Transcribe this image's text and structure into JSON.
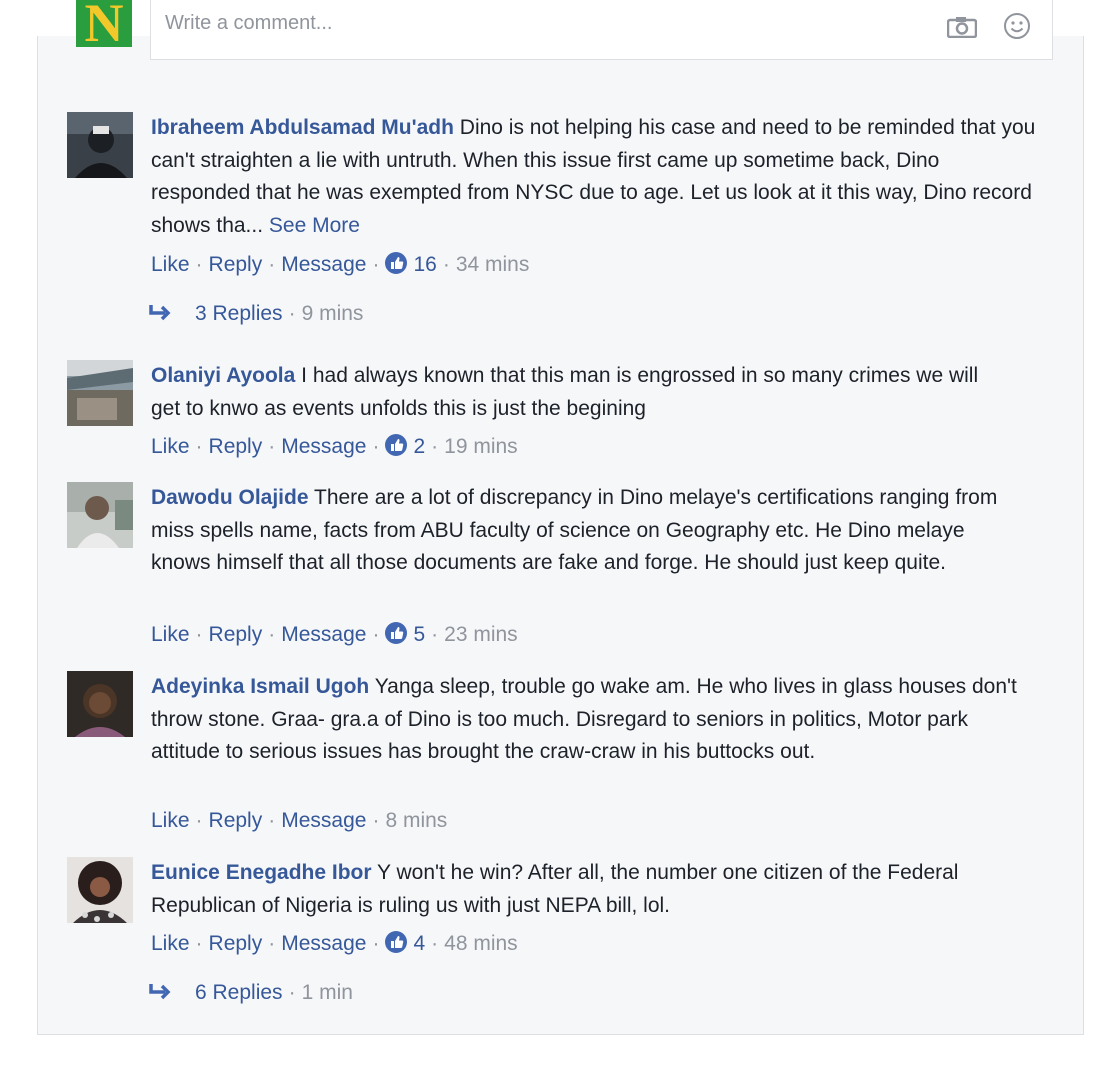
{
  "composer": {
    "avatar_letter": "N",
    "placeholder": "Write a comment...",
    "camera_icon": "camera-icon",
    "emoji_icon": "smiley-icon"
  },
  "comments": [
    {
      "author": "Ibraheem Abdulsamad Mu'adh",
      "text": "Dino is not helping his case and need to be reminded that you can't straighten a lie with untruth. When this issue first came up sometime back, Dino responded that he was exempted from NYSC due to age. Let us look at it this way, Dino record shows tha...",
      "see_more": "See More",
      "like": "Like",
      "reply": "Reply",
      "message": "Message",
      "likes": "16",
      "time": "34 mins",
      "replies": "3 Replies",
      "replies_time": "9 mins"
    },
    {
      "author": "Olaniyi Ayoola",
      "text": "I had always known that this man is engrossed in so many crimes we will get to knwo as events unfolds this is just the begining",
      "like": "Like",
      "reply": "Reply",
      "message": "Message",
      "likes": "2",
      "time": "19 mins"
    },
    {
      "author": "Dawodu Olajide",
      "text": "There are a lot of discrepancy in Dino melaye's certifications ranging from miss spells name, facts from ABU faculty of science on Geography etc. He Dino melaye knows himself that all those documents are fake and forge. He should just keep quite.",
      "like": "Like",
      "reply": "Reply",
      "message": "Message",
      "likes": "5",
      "time": "23 mins"
    },
    {
      "author": "Adeyinka Ismail Ugoh",
      "text": "Yanga sleep, trouble go wake am. He who lives in glass houses don't throw stone. Graa- gra.a of Dino is too much. Disregard to seniors in politics, Motor park attitude to serious issues has brought the craw-craw in his buttocks out.",
      "like": "Like",
      "reply": "Reply",
      "message": "Message",
      "time": "8 mins"
    },
    {
      "author": "Eunice Enegadhe Ibor",
      "text": "Y won't he win? After all, the number one citizen of the Federal Republican of Nigeria is ruling us with just NEPA bill, lol.",
      "like": "Like",
      "reply": "Reply",
      "message": "Message",
      "likes": "4",
      "time": "48 mins",
      "replies": "6 Replies",
      "replies_time": "1 min"
    }
  ],
  "colors": {
    "link": "#365899",
    "meta": "#90949c",
    "like_badge": "#4267b2",
    "panel_bg": "#f6f7f9"
  }
}
